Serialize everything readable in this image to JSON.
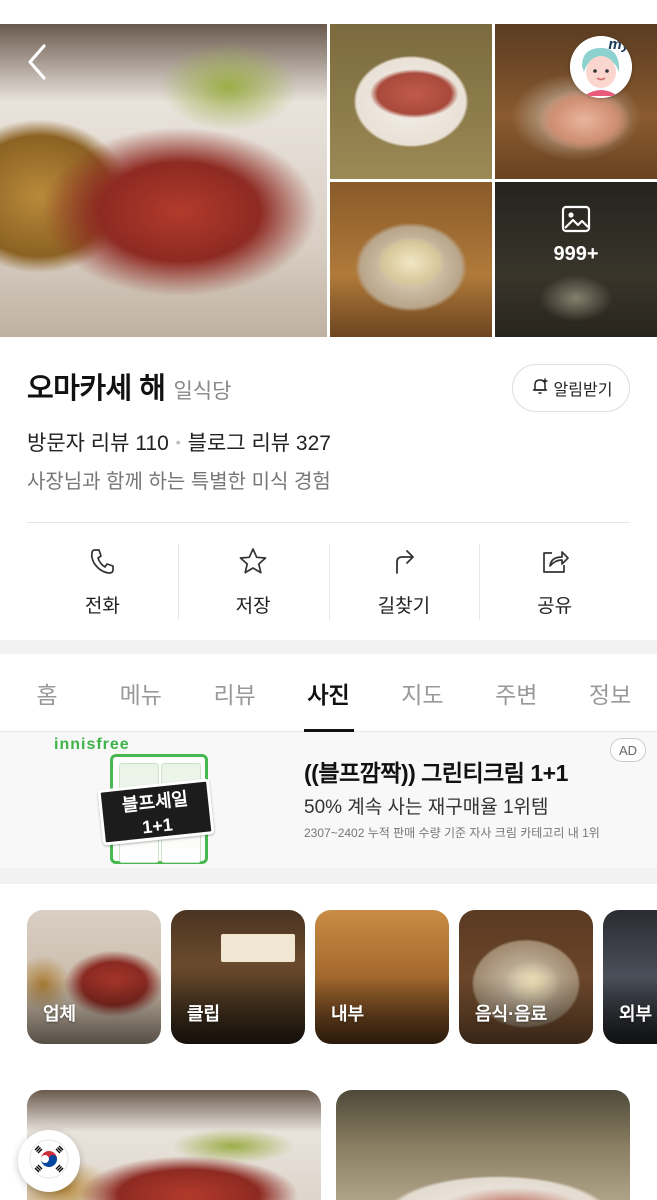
{
  "gallery": {
    "photo_count": "999+",
    "back_icon": "chevron-left-icon",
    "gallery_icon": "image-icon",
    "profile_badge": "my"
  },
  "place": {
    "name": "오마카세 해",
    "category": "일식당",
    "visitor_reviews": "방문자 리뷰 110",
    "blog_reviews": "블로그 리뷰 327",
    "description": "사장님과 함께 하는 특별한 미식 경험",
    "alarm_label": "알림받기"
  },
  "actions": [
    {
      "label": "전화",
      "icon": "phone-icon"
    },
    {
      "label": "저장",
      "icon": "star-icon"
    },
    {
      "label": "길찾기",
      "icon": "directions-icon"
    },
    {
      "label": "공유",
      "icon": "share-icon"
    }
  ],
  "tabs": [
    {
      "label": "홈",
      "active": false
    },
    {
      "label": "메뉴",
      "active": false
    },
    {
      "label": "리뷰",
      "active": false
    },
    {
      "label": "사진",
      "active": true
    },
    {
      "label": "지도",
      "active": false
    },
    {
      "label": "주변",
      "active": false
    },
    {
      "label": "정보",
      "active": false
    }
  ],
  "ad": {
    "brand": "innisfree",
    "sticker_line1": "블프세일",
    "sticker_line2": "1+1",
    "title": "((블프깜짝)) 그린티크림 1+1",
    "subtitle": "50% 계속 사는 재구매율 1위템",
    "note": "2307~2402 누적 판매 수량 기준 자사 크림 카테고리 내 1위",
    "badge": "AD"
  },
  "categories": [
    {
      "label": "업체"
    },
    {
      "label": "클립"
    },
    {
      "label": "내부"
    },
    {
      "label": "음식·음료"
    },
    {
      "label": "외부"
    }
  ],
  "colors": {
    "active_tab": "#111111",
    "inactive_tab": "#999999",
    "ad_brand_green": "#3db34a"
  }
}
